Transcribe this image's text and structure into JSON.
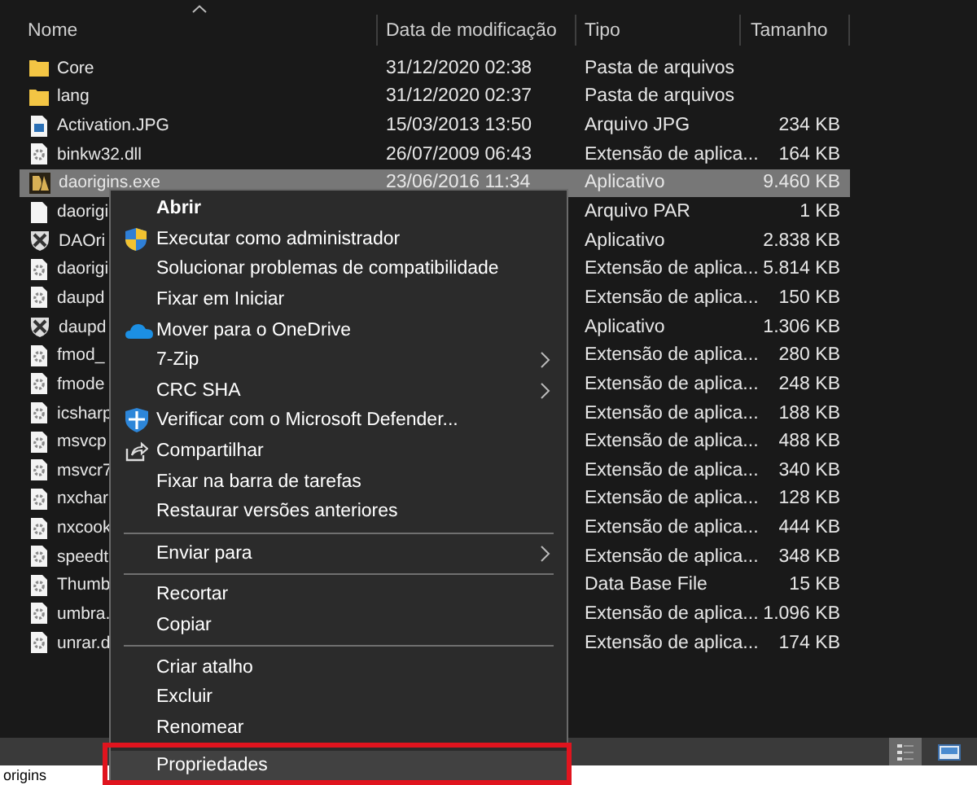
{
  "columns": [
    {
      "label": "Nome",
      "sorted": true
    },
    {
      "label": "Data de modificação",
      "sorted": false
    },
    {
      "label": "Tipo",
      "sorted": false
    },
    {
      "label": "Tamanho",
      "sorted": false
    }
  ],
  "rows": [
    {
      "kind": "folder",
      "name": "Core",
      "date": "31/12/2020 02:38",
      "type": "Pasta de arquivos",
      "selected": false
    },
    {
      "kind": "folder",
      "name": "lang",
      "date": "31/12/2020 02:37",
      "type": "Pasta de arquivos",
      "selected": false
    },
    {
      "kind": "image",
      "name": "Activation.JPG",
      "date": "15/03/2013 13:50",
      "type": "Arquivo JPG",
      "size": "234 KB",
      "selected": false
    },
    {
      "kind": "library",
      "name": "binkw32.dll",
      "date": "26/07/2009 06:43",
      "type": "Extensão de aplica...",
      "size": "164 KB",
      "selected": false
    },
    {
      "kind": "game",
      "name": "daorigins.exe",
      "date": "23/06/2016 11:34",
      "type": "Aplicativo",
      "size": "9.460 KB",
      "selected": true
    },
    {
      "kind": "blank",
      "name": "daorigi",
      "type": "Arquivo PAR",
      "size": "1 KB",
      "selected": false
    },
    {
      "kind": "crest",
      "name": "DAOri",
      "type": "Aplicativo",
      "size": "2.838 KB",
      "selected": false
    },
    {
      "kind": "library",
      "name": "daorigi",
      "type": "Extensão de aplica...",
      "size": "5.814 KB",
      "selected": false
    },
    {
      "kind": "library",
      "name": "daupd",
      "type": "Extensão de aplica...",
      "size": "150 KB",
      "selected": false
    },
    {
      "kind": "crest",
      "name": "daupd",
      "type": "Aplicativo",
      "size": "1.306 KB",
      "selected": false
    },
    {
      "kind": "library",
      "name": "fmod_",
      "type": "Extensão de aplica...",
      "size": "280 KB",
      "selected": false
    },
    {
      "kind": "library",
      "name": "fmode",
      "type": "Extensão de aplica...",
      "size": "248 KB",
      "selected": false
    },
    {
      "kind": "library",
      "name": "icsharp",
      "type": "Extensão de aplica...",
      "size": "188 KB",
      "selected": false
    },
    {
      "kind": "library",
      "name": "msvcp",
      "type": "Extensão de aplica...",
      "size": "488 KB",
      "selected": false
    },
    {
      "kind": "library",
      "name": "msvcr7",
      "type": "Extensão de aplica...",
      "size": "340 KB",
      "selected": false
    },
    {
      "kind": "library",
      "name": "nxchar",
      "type": "Extensão de aplica...",
      "size": "128 KB",
      "selected": false
    },
    {
      "kind": "library",
      "name": "nxcook",
      "type": "Extensão de aplica...",
      "size": "444 KB",
      "selected": false
    },
    {
      "kind": "library",
      "name": "speedt",
      "type": "Extensão de aplica...",
      "size": "348 KB",
      "selected": false
    },
    {
      "kind": "library",
      "name": "Thumb",
      "type": "Data Base File",
      "size": "15 KB",
      "selected": false
    },
    {
      "kind": "library",
      "name": "umbra.",
      "type": "Extensão de aplica...",
      "size": "1.096 KB",
      "selected": false
    },
    {
      "kind": "library",
      "name": "unrar.d",
      "type": "Extensão de aplica...",
      "size": "174 KB",
      "selected": false
    }
  ],
  "context_menu": {
    "items": [
      {
        "kind": "plain",
        "label": "Abrir",
        "bold": true,
        "selected": false
      },
      {
        "kind": "admin",
        "label": "Executar como administrador",
        "bold": false,
        "selected": false
      },
      {
        "kind": "plain",
        "label": "Solucionar problemas de compatibilidade",
        "bold": false,
        "selected": false
      },
      {
        "kind": "plain",
        "label": "Fixar em Iniciar",
        "bold": false,
        "selected": false
      },
      {
        "kind": "cloud",
        "label": "Mover para o OneDrive",
        "bold": false,
        "selected": false
      },
      {
        "kind": "submenu",
        "label": "7-Zip",
        "bold": false,
        "selected": false
      },
      {
        "kind": "submenu",
        "label": "CRC SHA",
        "bold": false,
        "selected": false
      },
      {
        "kind": "scan",
        "label": "Verificar com o Microsoft Defender...",
        "bold": false,
        "selected": false
      },
      {
        "kind": "share",
        "label": "Compartilhar",
        "bold": false,
        "selected": false
      },
      {
        "kind": "plain",
        "label": "Fixar na barra de tarefas",
        "bold": false,
        "selected": false
      },
      {
        "kind": "plain",
        "label": "Restaurar versões anteriores",
        "bold": false,
        "selected": false
      },
      {
        "kind": "separator"
      },
      {
        "kind": "submenu",
        "label": "Enviar para",
        "bold": false,
        "selected": false
      },
      {
        "kind": "separator"
      },
      {
        "kind": "plain",
        "label": "Recortar",
        "bold": false,
        "selected": false
      },
      {
        "kind": "plain",
        "label": "Copiar",
        "bold": false,
        "selected": false
      },
      {
        "kind": "separator"
      },
      {
        "kind": "plain",
        "label": "Criar atalho",
        "bold": false,
        "selected": false
      },
      {
        "kind": "plain",
        "label": "Excluir",
        "bold": false,
        "selected": false
      },
      {
        "kind": "plain",
        "label": "Renomear",
        "bold": false,
        "selected": false
      },
      {
        "kind": "gap"
      },
      {
        "kind": "plain",
        "label": "Propriedades",
        "bold": false,
        "selected": true,
        "outlined": true
      }
    ]
  },
  "status_bar": {
    "views": [
      {
        "kind": "details",
        "selected": true
      },
      {
        "kind": "tiles",
        "selected": false
      }
    ]
  },
  "background_text": "origins"
}
